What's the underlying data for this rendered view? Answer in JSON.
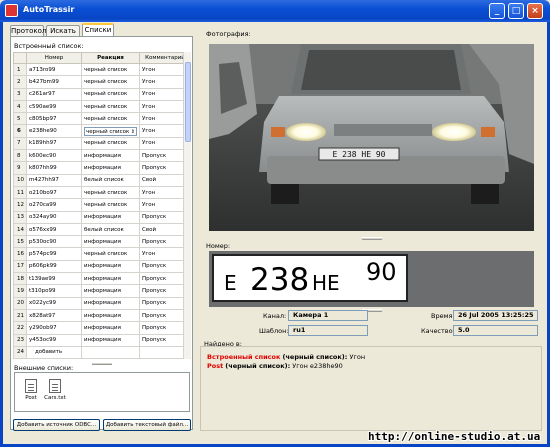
{
  "window": {
    "title": "AutoTrassir"
  },
  "tabs": [
    "Протокол",
    "Искать",
    "Списки"
  ],
  "builtin_lists_label": "Встроенный список:",
  "table": {
    "headers": [
      "",
      "Номер",
      "Реакция",
      "Комментарий"
    ],
    "rows": [
      [
        "1",
        "a713ro99",
        "черный список",
        "Угон"
      ],
      [
        "2",
        "b427bm99",
        "черный список",
        "Угон"
      ],
      [
        "3",
        "c261ar97",
        "черный список",
        "Угон"
      ],
      [
        "4",
        "c590ae99",
        "черный список",
        "Угон"
      ],
      [
        "5",
        "c805bp97",
        "черный список",
        "Угон"
      ],
      [
        "6",
        "e238he90",
        "черный список",
        "Угон"
      ],
      [
        "7",
        "k189hh97",
        "черный список",
        "Угон"
      ],
      [
        "8",
        "k600ec90",
        "информация",
        "Пропуск"
      ],
      [
        "9",
        "k807hh99",
        "информация",
        "Пропуск"
      ],
      [
        "10",
        "m427hh97",
        "белый список",
        "Свой"
      ],
      [
        "11",
        "o210bo97",
        "черный список",
        "Угон"
      ],
      [
        "12",
        "o270ca99",
        "черный список",
        "Угон"
      ],
      [
        "13",
        "o324ay90",
        "информация",
        "Пропуск"
      ],
      [
        "14",
        "o576xx99",
        "белый список",
        "Свой"
      ],
      [
        "15",
        "p530oc90",
        "информация",
        "Пропуск"
      ],
      [
        "16",
        "p574pc99",
        "черный список",
        "Угон"
      ],
      [
        "17",
        "p606pk99",
        "информация",
        "Пропуск"
      ],
      [
        "18",
        "t139ae99",
        "информация",
        "Пропуск"
      ],
      [
        "19",
        "t310po99",
        "информация",
        "Пропуск"
      ],
      [
        "20",
        "x022yc99",
        "информация",
        "Пропуск"
      ],
      [
        "21",
        "x828at97",
        "информация",
        "Пропуск"
      ],
      [
        "22",
        "y290ob97",
        "информация",
        "Пропуск"
      ],
      [
        "23",
        "y453oc99",
        "информация",
        "Пропуск"
      ]
    ],
    "add_row": {
      "num": "24",
      "label": "добавить"
    }
  },
  "external_lists_label": "Внешние списки:",
  "external_files": [
    "Post",
    "Cars.txt"
  ],
  "buttons": {
    "add_odbc": "Добавить источник ODBC...",
    "add_text": "Добавить текстовый файл..."
  },
  "photo_label": "Фотография:",
  "number_label": "Номер:",
  "plate": {
    "letter1": "Е",
    "digits": "238",
    "letters2": "НЕ",
    "region": "90"
  },
  "photo_plate_text": "Е 238 НЕ 90",
  "fields": {
    "channel_label": "Канал:",
    "channel_value": "Камера 1",
    "time_label": "Время:",
    "time_value": "26 Jul 2005 13:25:25",
    "template_label": "Шаблон:",
    "template_value": "ru1",
    "quality_label": "Качество:",
    "quality_value": "5.0"
  },
  "found_label": "Найдено в:",
  "found_lines": [
    {
      "source": "Встроенный список",
      "type": "(черный список):",
      "text": "Угон"
    },
    {
      "source": "Post",
      "type": "(черный список):",
      "text": "Угон e238he90"
    }
  ],
  "watermark": "http://online-studio.at.ua",
  "colors": {
    "titlebar": "#0a4fd4",
    "highlight_red": "#e00000"
  }
}
